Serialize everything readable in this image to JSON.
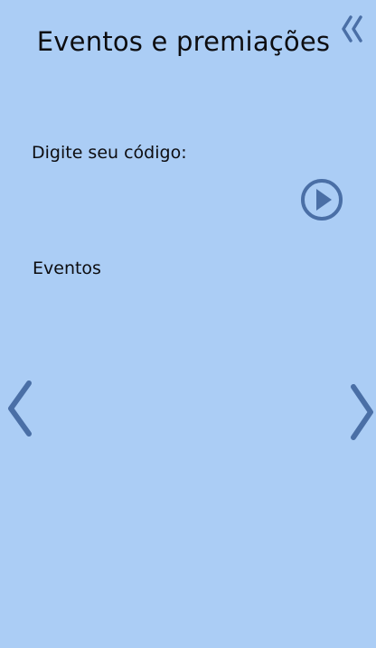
{
  "header": {
    "title": "Eventos e premiações",
    "collapse_icon": "double-chevron-left-icon"
  },
  "code": {
    "label": "Digite seu código:",
    "value": "",
    "submit_icon": "play-circle-icon"
  },
  "events": {
    "label": "Eventos",
    "prev_icon": "chevron-left-icon",
    "next_icon": "chevron-right-icon"
  },
  "colors": {
    "background": "#abcdf5",
    "icon": "#4a6fa6",
    "text": "#0d0d10"
  }
}
